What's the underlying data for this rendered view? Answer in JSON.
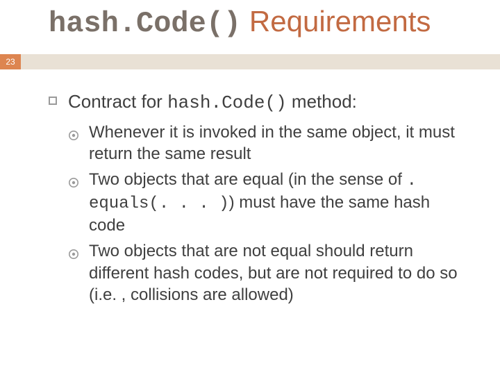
{
  "page_number": "23",
  "title_mono": "hash.Code()",
  "title_rest": " Requirements",
  "lvl1_pre": "Contract for ",
  "lvl1_mono": "hash.Code()",
  "lvl1_post": " method:",
  "b1": "Whenever it is invoked in the same object, it must return the same result",
  "b2_pre": "Two objects that are equal (in the sense of ",
  "b2_mono": ". equals(. . . )",
  "b2_post": ") must have the same hash code",
  "b3": "Two objects that are not equal should return different hash codes, but are not required to do so (i.e. , collisions are allowed)"
}
